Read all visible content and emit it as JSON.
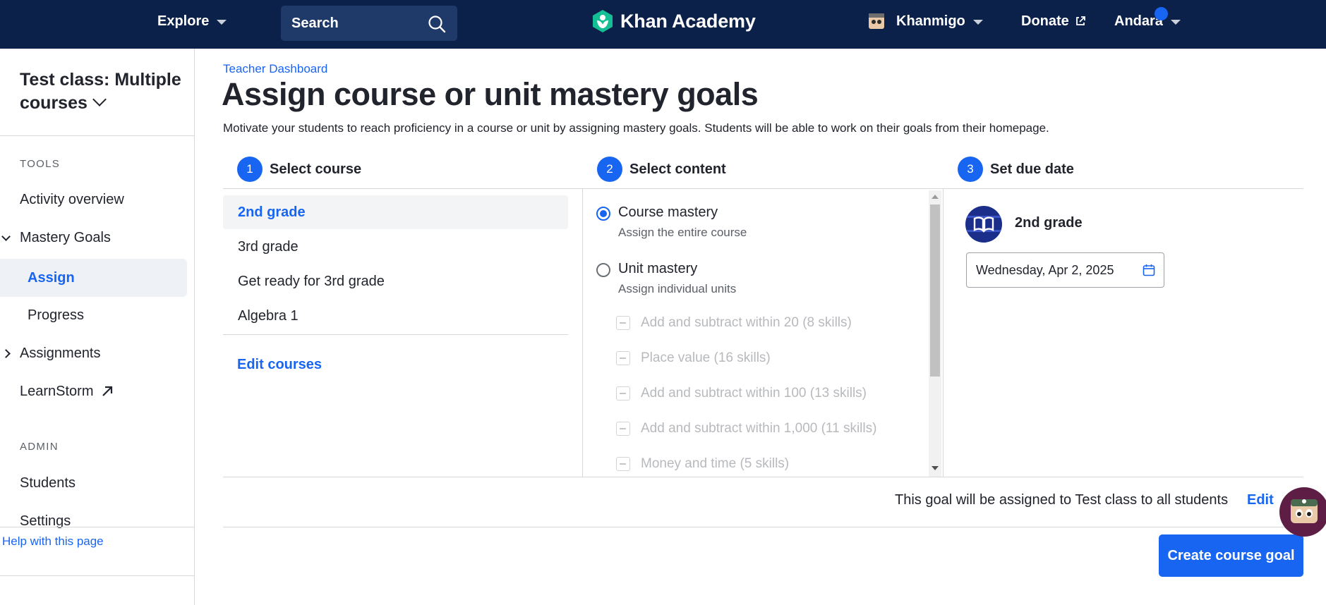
{
  "topnav": {
    "explore_label": "Explore",
    "search_placeholder": "Search",
    "brand_name": "Khan Academy",
    "khanmigo_label": "Khanmigo",
    "donate_label": "Donate",
    "user_name": "Andara"
  },
  "sidebar": {
    "class_title": "Test class: Multiple courses",
    "tools_label": "TOOLS",
    "items": {
      "activity_overview": "Activity overview",
      "mastery_goals": "Mastery Goals",
      "assign": "Assign",
      "progress": "Progress",
      "assignments": "Assignments",
      "learnstorm": "LearnStorm"
    },
    "admin_label": "ADMIN",
    "admin_items": {
      "students": "Students",
      "settings": "Settings"
    },
    "help_link": "Help with this page"
  },
  "main": {
    "breadcrumb": "Teacher Dashboard",
    "title": "Assign course or unit mastery goals",
    "description": "Motivate your students to reach proficiency in a course or unit by assigning mastery goals. Students will be able to work on their goals from their homepage.",
    "steps": [
      {
        "num": "1",
        "label": "Select course"
      },
      {
        "num": "2",
        "label": "Select content"
      },
      {
        "num": "3",
        "label": "Set due date"
      }
    ],
    "courses": [
      "2nd grade",
      "3rd grade",
      "Get ready for 3rd grade",
      "Algebra 1"
    ],
    "selected_course": "2nd grade",
    "edit_courses": "Edit courses",
    "content_options": {
      "course_mastery_title": "Course mastery",
      "course_mastery_sub": "Assign the entire course",
      "unit_mastery_title": "Unit mastery",
      "unit_mastery_sub": "Assign individual units",
      "selected": "course_mastery"
    },
    "units": [
      "Add and subtract within 20 (8 skills)",
      "Place value (16 skills)",
      "Add and subtract within 100 (13 skills)",
      "Add and subtract within 1,000 (11 skills)",
      "Money and time (5 skills)"
    ],
    "due": {
      "course_name": "2nd grade",
      "date_value": "Wednesday, Apr 2, 2025"
    },
    "assign_note": "This goal will be assigned to Test class to all students",
    "edit_label": "Edit",
    "create_button": "Create course goal"
  },
  "colors": {
    "nav_bg": "#0b2149",
    "accent": "#1865f2",
    "text": "#21242c",
    "muted": "#5b5f66",
    "disabled": "#b7b9bd"
  }
}
